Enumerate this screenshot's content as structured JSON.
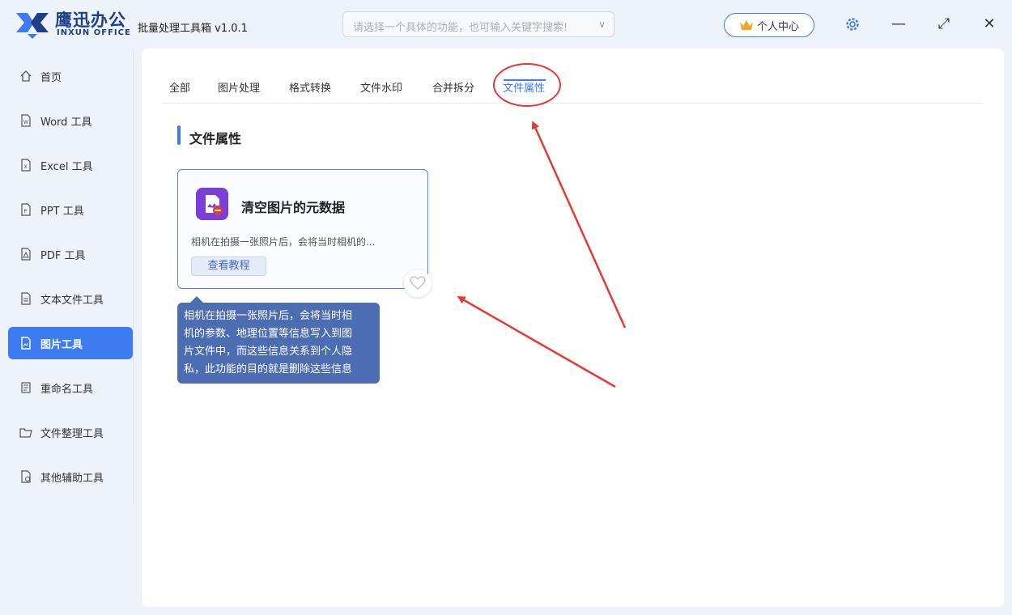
{
  "brand": {
    "name_cn": "鹰迅办公",
    "name_en": "INXUN OFFICE"
  },
  "app_title": "批量处理工具箱 v1.0.1",
  "search": {
    "placeholder": "请选择一个具体的功能，也可输入关键字搜索!"
  },
  "user_center": {
    "label": "个人中心"
  },
  "sidebar": {
    "items": [
      {
        "label": "首页",
        "icon": "home-icon"
      },
      {
        "label": "Word 工具",
        "icon": "word-file-icon"
      },
      {
        "label": "Excel 工具",
        "icon": "excel-file-icon"
      },
      {
        "label": "PPT 工具",
        "icon": "ppt-file-icon"
      },
      {
        "label": "PDF 工具",
        "icon": "pdf-file-icon"
      },
      {
        "label": "文本文件工具",
        "icon": "text-file-icon"
      },
      {
        "label": "图片工具",
        "icon": "image-file-icon",
        "active": true
      },
      {
        "label": "重命名工具",
        "icon": "rename-icon"
      },
      {
        "label": "文件整理工具",
        "icon": "folder-icon"
      },
      {
        "label": "其他辅助工具",
        "icon": "misc-tool-icon"
      }
    ]
  },
  "tabs": [
    {
      "label": "全部"
    },
    {
      "label": "图片处理"
    },
    {
      "label": "格式转换"
    },
    {
      "label": "文件水印"
    },
    {
      "label": "合并拆分"
    },
    {
      "label": "文件属性",
      "active": true
    }
  ],
  "section": {
    "title": "文件属性"
  },
  "card": {
    "title": "清空图片的元数据",
    "description": "相机在拍摄一张照片后，会将当时相机的...",
    "button": "查看教程",
    "icon": "image-metadata-icon"
  },
  "tooltip": {
    "lines": [
      "相机在拍摄一张照片后，会将当时相",
      "机的参数、地理位置等信息写入到图",
      "片文件中，而这些信息关系到个人隐",
      "私，此功能的目的就是删除这些信息"
    ]
  },
  "colors": {
    "accent": "#3d7bf0",
    "brand": "#1e3f8a",
    "annotation_red": "#e53935",
    "tooltip_bg": "#4d6db3"
  }
}
